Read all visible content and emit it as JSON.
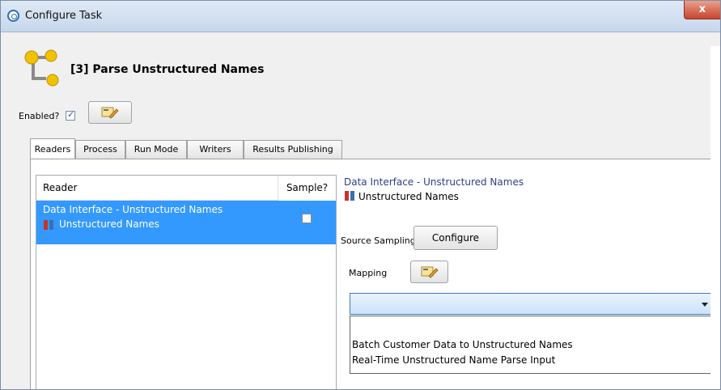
{
  "window": {
    "title": "Configure Task",
    "close_label": "x"
  },
  "task": {
    "title": "[3] Parse Unstructured Names",
    "enabled_label": "Enabled?",
    "enabled": true
  },
  "tabs": [
    {
      "label": "Readers",
      "active": true
    },
    {
      "label": "Process",
      "active": false
    },
    {
      "label": "Run Mode",
      "active": false
    },
    {
      "label": "Writers",
      "active": false
    },
    {
      "label": "Results Publishing",
      "active": false
    }
  ],
  "readers_table": {
    "columns": [
      "Reader",
      "Sample?"
    ],
    "rows": [
      {
        "reader_line1": "Data Interface - Unstructured Names",
        "reader_line2": "Unstructured Names",
        "sample": false,
        "selected": true
      }
    ]
  },
  "detail": {
    "interface_title": "Data Interface - Unstructured Names",
    "interface_name": "Unstructured Names",
    "source_sampling_label": "Source Sampling",
    "configure_label": "Configure",
    "mapping_label": "Mapping",
    "mapping_value": "",
    "mapping_options": [
      "Batch Customer Data to Unstructured Names",
      "Real-Time Unstructured Name Parse Input"
    ]
  },
  "colors": {
    "selection": "#3399ff",
    "link_title": "#2c3e8a",
    "close_button": "#c8452c"
  },
  "icons": [
    "app-icon",
    "task-tree-icon",
    "edit-icon",
    "data-interface-icon",
    "dropdown-arrow-icon"
  ]
}
